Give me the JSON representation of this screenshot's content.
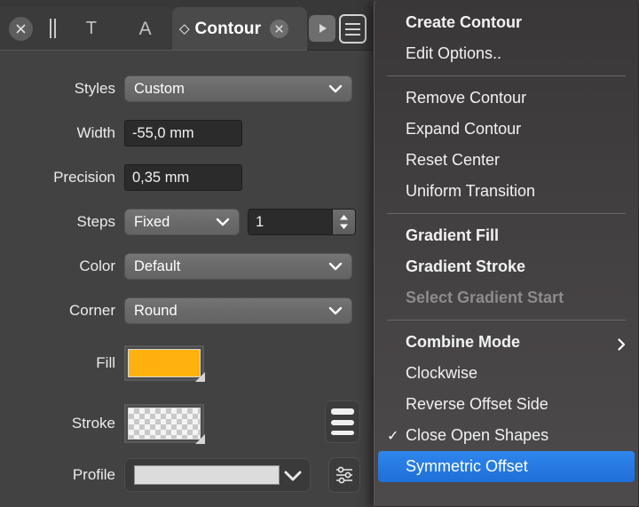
{
  "toolbar": {
    "tools": [
      {
        "name": "close-circle-icon",
        "label": ""
      },
      {
        "name": "pause-divider-icon",
        "label": ""
      },
      {
        "name": "text-tool-icon",
        "label": "T"
      },
      {
        "name": "font-tool-icon",
        "label": "A"
      }
    ],
    "active_tab": {
      "label": "Contour",
      "diamond": "◇"
    },
    "play_button_label": "",
    "list_button_label": ""
  },
  "panel": {
    "rows": {
      "styles": {
        "label": "Styles",
        "value": "Custom"
      },
      "width": {
        "label": "Width",
        "value": "-55,0 mm"
      },
      "precision": {
        "label": "Precision",
        "value": "0,35 mm"
      },
      "steps": {
        "label": "Steps",
        "mode": "Fixed",
        "count": "1"
      },
      "color": {
        "label": "Color",
        "value": "Default"
      },
      "corner": {
        "label": "Corner",
        "value": "Round"
      },
      "fill": {
        "label": "Fill",
        "color": "#FFB20D"
      },
      "stroke": {
        "label": "Stroke",
        "color": "transparent"
      },
      "profile": {
        "label": "Profile",
        "value": ""
      }
    }
  },
  "context_menu": {
    "groups": [
      {
        "items": [
          {
            "label": "Create Contour",
            "bold": true,
            "checked": false,
            "disabled": false,
            "selected": false,
            "submenu": false
          },
          {
            "label": "Edit Options..",
            "bold": false,
            "checked": false,
            "disabled": false,
            "selected": false,
            "submenu": false
          }
        ]
      },
      {
        "items": [
          {
            "label": "Remove Contour",
            "bold": false,
            "checked": false,
            "disabled": false,
            "selected": false,
            "submenu": false
          },
          {
            "label": "Expand Contour",
            "bold": false,
            "checked": false,
            "disabled": false,
            "selected": false,
            "submenu": false
          },
          {
            "label": "Reset Center",
            "bold": false,
            "checked": false,
            "disabled": false,
            "selected": false,
            "submenu": false
          },
          {
            "label": "Uniform Transition",
            "bold": false,
            "checked": false,
            "disabled": false,
            "selected": false,
            "submenu": false
          }
        ]
      },
      {
        "items": [
          {
            "label": "Gradient Fill",
            "bold": true,
            "checked": false,
            "disabled": false,
            "selected": false,
            "submenu": false
          },
          {
            "label": "Gradient Stroke",
            "bold": true,
            "checked": false,
            "disabled": false,
            "selected": false,
            "submenu": false
          },
          {
            "label": "Select Gradient Start",
            "bold": true,
            "checked": false,
            "disabled": true,
            "selected": false,
            "submenu": false
          }
        ]
      },
      {
        "items": [
          {
            "label": "Combine Mode",
            "bold": true,
            "checked": false,
            "disabled": false,
            "selected": false,
            "submenu": true
          },
          {
            "label": "Clockwise",
            "bold": false,
            "checked": false,
            "disabled": false,
            "selected": false,
            "submenu": false
          },
          {
            "label": "Reverse Offset Side",
            "bold": false,
            "checked": false,
            "disabled": false,
            "selected": false,
            "submenu": false
          },
          {
            "label": "Close Open Shapes",
            "bold": false,
            "checked": true,
            "disabled": false,
            "selected": false,
            "submenu": false
          },
          {
            "label": "Symmetric Offset",
            "bold": false,
            "checked": false,
            "disabled": false,
            "selected": true,
            "submenu": false
          }
        ]
      }
    ],
    "checkmark_glyph": "✓"
  },
  "colors": {
    "panel_bg": "#434242",
    "menu_bg": "#3f3c3d",
    "accent_selection": "#2f86ec",
    "fill_swatch": "#FFB20D",
    "field_bg": "#2b2b2b"
  }
}
